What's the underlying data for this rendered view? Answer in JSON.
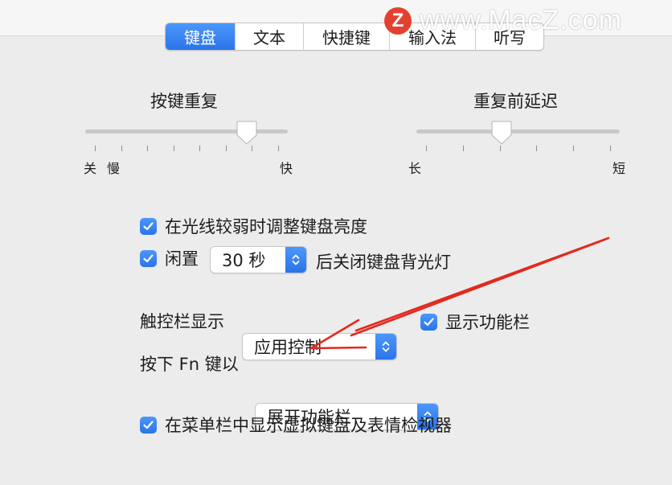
{
  "tabs": [
    {
      "label": "键盘",
      "active": true
    },
    {
      "label": "文本",
      "active": false
    },
    {
      "label": "快捷键",
      "active": false
    },
    {
      "label": "输入法",
      "active": false
    },
    {
      "label": "听写",
      "active": false
    }
  ],
  "watermark": {
    "logo_letter": "Z",
    "text": "www.MacZ.com"
  },
  "key_repeat": {
    "title": "按键重复",
    "min_label": "关",
    "slow_label": "慢",
    "max_label": "快",
    "level": 0.83
  },
  "repeat_delay": {
    "title": "重复前延迟",
    "min_label": "长",
    "max_label": "短",
    "level": 0.41
  },
  "options": {
    "adjust_brightness": {
      "label": "在光线较弱时调整键盘亮度",
      "checked": true
    },
    "backlight_off": {
      "prefix": "闲置",
      "value": "30 秒",
      "suffix": "后关闭键盘背光灯",
      "checked": true
    }
  },
  "touch_bar": {
    "label": "触控栏显示",
    "value": "应用控制",
    "show_fn_label": "显示功能栏",
    "show_fn_checked": true
  },
  "fn_key": {
    "label": "按下 Fn 键以",
    "value": "展开功能栏"
  },
  "menu_bar_viewer": {
    "label": "在菜单栏中显示虚拟键盘及表情检视器",
    "checked": true
  },
  "colors": {
    "accent": "#2f7cf0",
    "annotation": "#e12a1f",
    "background": "#ececec"
  }
}
